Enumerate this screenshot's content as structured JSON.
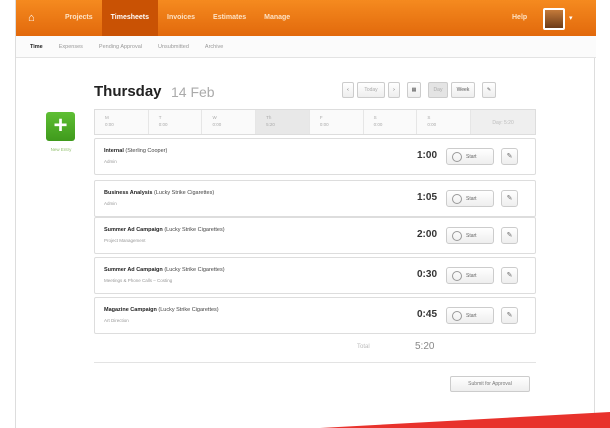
{
  "topnav": {
    "items": [
      {
        "label": "Projects",
        "active": false
      },
      {
        "label": "Timesheets",
        "active": true
      },
      {
        "label": "Invoices",
        "active": false
      },
      {
        "label": "Estimates",
        "active": false
      },
      {
        "label": "Manage",
        "active": false
      }
    ],
    "help": "Help"
  },
  "subnav": {
    "items": [
      {
        "label": "Time",
        "active": true
      },
      {
        "label": "Expenses",
        "active": false
      },
      {
        "label": "Pending Approval",
        "active": false
      },
      {
        "label": "Unsubmitted",
        "active": false
      },
      {
        "label": "Archive",
        "active": false
      }
    ]
  },
  "header": {
    "day": "Thursday",
    "date": "14 Feb"
  },
  "controls": {
    "prev": "‹",
    "today": "Today",
    "next": "›",
    "calendar": "▦",
    "day": "Day",
    "week": "Week",
    "edit": "✎"
  },
  "add": {
    "symbol": "+",
    "label": "New Entry"
  },
  "days": [
    {
      "name": "M",
      "hours": "0:00"
    },
    {
      "name": "T",
      "hours": "0:00"
    },
    {
      "name": "W",
      "hours": "0:00"
    },
    {
      "name": "Th",
      "hours": "5:20"
    },
    {
      "name": "F",
      "hours": "0:00"
    },
    {
      "name": "S",
      "hours": "0:00"
    },
    {
      "name": "S",
      "hours": "0:00"
    }
  ],
  "day_total": "Day: 5:20",
  "entries": [
    {
      "project": "Internal",
      "client": "(Sterling Cooper)",
      "task": "Admin",
      "time": "1:00",
      "button": "Start"
    },
    {
      "project": "Business Analysis",
      "client": "(Lucky Strike Cigarettes)",
      "task": "Admin",
      "time": "1:05",
      "button": "Start"
    },
    {
      "project": "Summer Ad Campaign",
      "client": "(Lucky Strike Cigarettes)",
      "task": "Project Management",
      "time": "2:00",
      "button": "Start"
    },
    {
      "project": "Summer Ad Campaign",
      "client": "(Lucky Strike Cigarettes)",
      "task": "Meetings & Phone Calls – Costing",
      "time": "0:30",
      "button": "Start"
    },
    {
      "project": "Magazine Campaign",
      "client": "(Lucky Strike Cigarettes)",
      "task": "Art Direction",
      "time": "0:45",
      "button": "Start"
    }
  ],
  "total": {
    "label": "Total",
    "value": "5:20"
  },
  "submit": "Submit for Approval",
  "colors": {
    "brand_orange": "#f07d16",
    "nav_active": "#c95204",
    "add_green": "#4fae27",
    "accent_red": "#e8322c"
  }
}
